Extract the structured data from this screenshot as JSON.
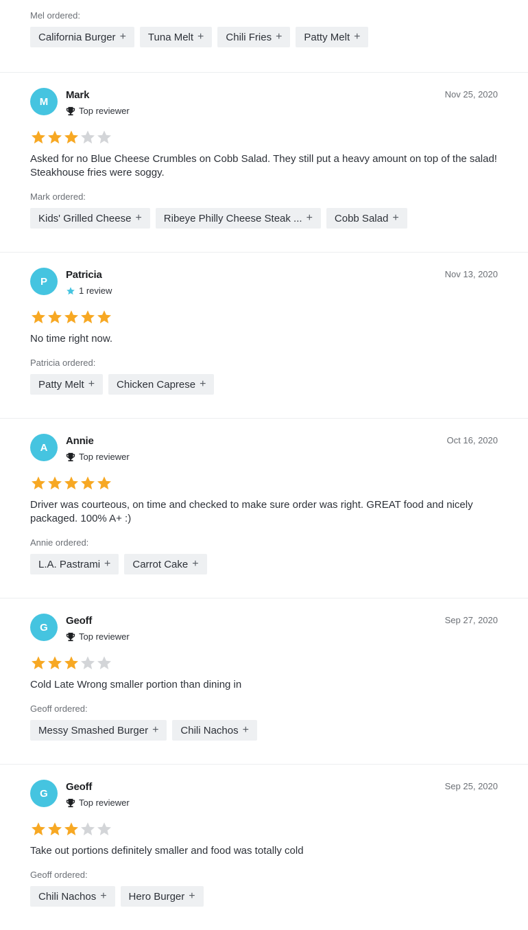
{
  "top": {
    "ordered_label": "Mel ordered:",
    "items": [
      "California Burger",
      "Tuna Melt",
      "Chili Fries",
      "Patty Melt"
    ]
  },
  "reviews": [
    {
      "initial": "M",
      "name": "Mark",
      "badge": "Top reviewer",
      "badge_icon": "trophy-icon",
      "date": "Nov 25, 2020",
      "rating": 3,
      "text": "Asked for no Blue Cheese Crumbles on Cobb Salad. They still put a heavy amount on top of the salad! Steakhouse fries were soggy.",
      "ordered_label": "Mark ordered:",
      "items": [
        "Kids' Grilled Cheese",
        "Ribeye Philly Cheese Steak ...",
        "Cobb Salad"
      ]
    },
    {
      "initial": "P",
      "name": "Patricia",
      "badge": "1 review",
      "badge_icon": "star-icon",
      "date": "Nov 13, 2020",
      "rating": 5,
      "text": "No time right now.",
      "ordered_label": "Patricia ordered:",
      "items": [
        "Patty Melt",
        "Chicken Caprese"
      ]
    },
    {
      "initial": "A",
      "name": "Annie",
      "badge": "Top reviewer",
      "badge_icon": "trophy-icon",
      "date": "Oct 16, 2020",
      "rating": 5,
      "text": "Driver was courteous, on time and checked to make sure order was right. GREAT food and nicely packaged. 100% A+ :)",
      "ordered_label": "Annie ordered:",
      "items": [
        "L.A. Pastrami",
        "Carrot Cake"
      ]
    },
    {
      "initial": "G",
      "name": "Geoff",
      "badge": "Top reviewer",
      "badge_icon": "trophy-icon",
      "date": "Sep 27, 2020",
      "rating": 3,
      "text": "Cold Late Wrong smaller portion than dining in",
      "ordered_label": "Geoff ordered:",
      "items": [
        "Messy Smashed Burger",
        "Chili Nachos"
      ]
    },
    {
      "initial": "G",
      "name": "Geoff",
      "badge": "Top reviewer",
      "badge_icon": "trophy-icon",
      "date": "Sep 25, 2020",
      "rating": 3,
      "text": "Take out portions definitely smaller and food was totally cold",
      "ordered_label": "Geoff ordered:",
      "items": [
        "Chili Nachos",
        "Hero Burger"
      ]
    }
  ],
  "colors": {
    "avatar": "#45c4e0",
    "star_filled": "#f7a823",
    "star_empty": "#d3d5d8",
    "chip_bg": "#eef0f2",
    "badge_star": "#45c4e0"
  },
  "add_glyph": "+"
}
